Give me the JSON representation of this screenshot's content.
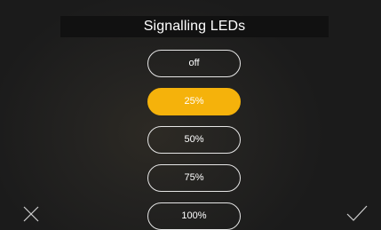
{
  "header": {
    "title": "Signalling LEDs"
  },
  "options": [
    {
      "label": "off",
      "selected": false
    },
    {
      "label": "25%",
      "selected": true
    },
    {
      "label": "50%",
      "selected": false
    },
    {
      "label": "75%",
      "selected": false
    },
    {
      "label": "100%",
      "selected": false
    }
  ],
  "footer": {
    "cancel_icon": "close-icon",
    "confirm_icon": "check-icon"
  },
  "colors": {
    "accent": "#f5b20b",
    "background": "#1b1b1b",
    "title_bar": "#111111",
    "text": "#ffffff"
  }
}
